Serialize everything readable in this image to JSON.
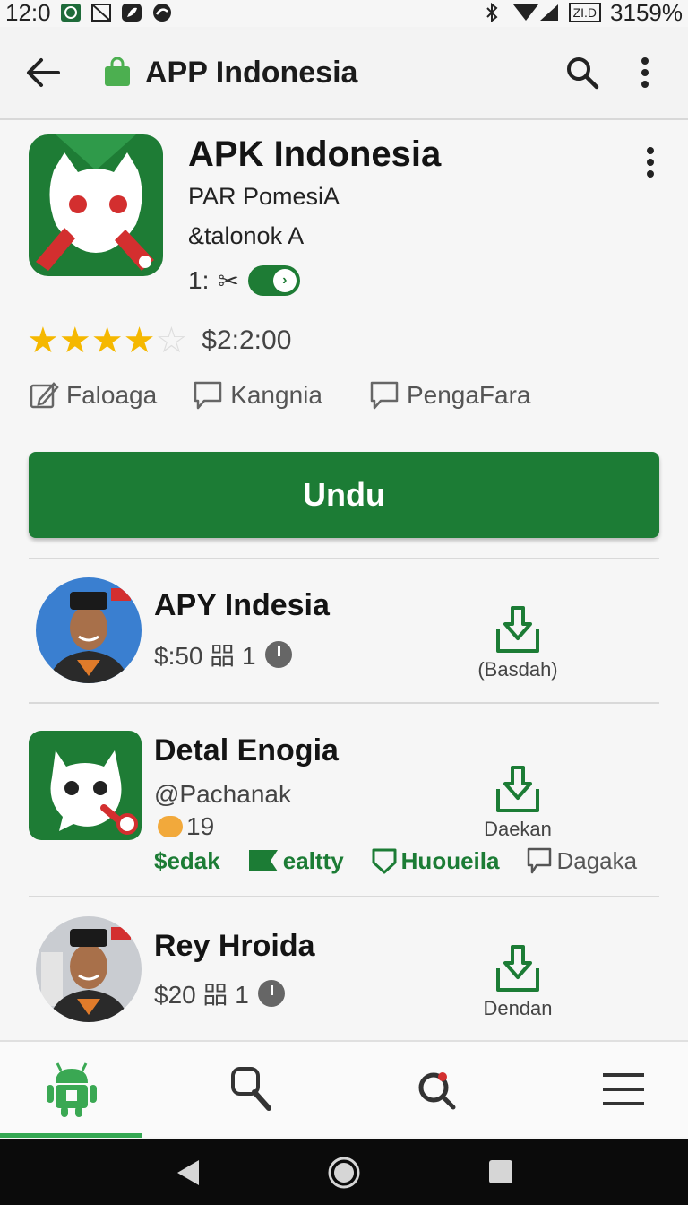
{
  "status_bar": {
    "time": "12:0",
    "battery": "3159%",
    "badge": "ZI.D"
  },
  "app_bar": {
    "title": "APP Indonesia"
  },
  "app_header": {
    "name": "APK Indonesia",
    "developer": "PAR PomesiA",
    "subtitle": "&talonok A",
    "meta_prefix": "1:",
    "meta_symbol": "✂",
    "rating_value": 4,
    "rating_max": 5,
    "price": "$2:2:00",
    "tags": [
      "Faloaga",
      "Kangnia",
      "PengaFara"
    ]
  },
  "download_button": {
    "label": "Undu"
  },
  "list": [
    {
      "title": "APY Indesia",
      "price": "$:50 㗊 1",
      "action": "(Basdah)"
    },
    {
      "title": "Detal Enogia",
      "handle": "@Pachanak",
      "count": "19",
      "action": "Daekan",
      "tags": [
        "$edak",
        "ealtty",
        "Huoueila",
        "Dagaka"
      ]
    },
    {
      "title": "Rey Hroida",
      "price": "$20 㗊 1",
      "action": "Dendan"
    }
  ],
  "bottom_nav": [
    {
      "name": "android-tab",
      "icon": "android-icon",
      "active": true
    },
    {
      "name": "search-tab",
      "icon": "search-icon",
      "active": false
    },
    {
      "name": "discover-tab",
      "icon": "search-dot-icon",
      "active": false
    },
    {
      "name": "menu-tab",
      "icon": "menu-icon",
      "active": false
    }
  ],
  "colors": {
    "brand_green": "#1c7c35",
    "nav_green": "#35a853",
    "star": "#f5b800"
  }
}
